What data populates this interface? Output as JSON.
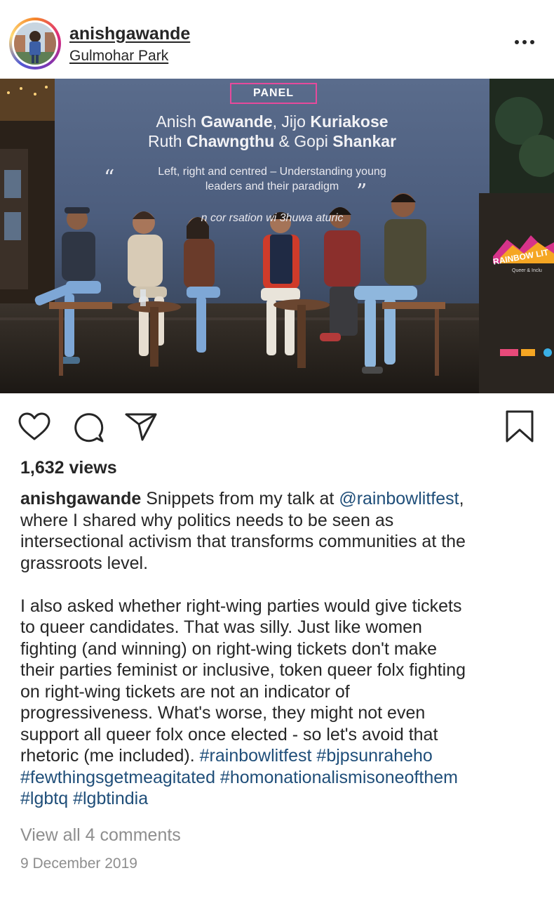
{
  "post": {
    "username": "anishgawande",
    "location": "Gulmohar Park",
    "more_icon": "more-horizontal-icon"
  },
  "media": {
    "screen": {
      "panel_tag": "PANEL",
      "speakers_line1_a": "Anish ",
      "speakers_line1_b": "Gawande",
      "speakers_line1_c": ", Jijo ",
      "speakers_line1_d": "Kuriakose",
      "speakers_line2_a": "Ruth ",
      "speakers_line2_b": "Chawngthu",
      "speakers_line2_c": " & Gopi ",
      "speakers_line2_d": "Shankar",
      "topic_line1": "Left, right and centred – Understanding young",
      "topic_line2": "leaders and their paradigm",
      "quote_open": "“",
      "quote_close": "”",
      "conversation": "n cor  rsation wi  3huwa   aturic"
    },
    "banner_title": "RAINBOW LIT",
    "banner_sub": "Queer & Inclu"
  },
  "actions": {
    "like_icon": "heart-icon",
    "comment_icon": "comment-bubble-icon",
    "share_icon": "paper-plane-icon",
    "save_icon": "bookmark-icon"
  },
  "stats": {
    "views": "1,632 views"
  },
  "caption": {
    "username": "anishgawande",
    "text_1": " Snippets from my talk at ",
    "mention": "@rainbowlitfest",
    "text_2": ",\nwhere I shared why politics needs to be seen as\nintersectional activism that transforms communities at the\ngrassroots level.\n\nI also asked whether right-wing parties would give tickets\nto queer candidates. That was silly. Just like women\nfighting (and winning) on right-wing tickets don't make\ntheir parties feminist or inclusive, token queer folx fighting\non right-wing tickets are not an indicator of\nprogressiveness. What's worse, they might not even\nsupport all queer folx once elected - so let's avoid that\nrhetoric (me included). ",
    "hashtags": [
      "#rainbowlitfest",
      "#bjpsunraheho",
      "#fewthingsgetmeagitated",
      "#homonationalismisoneofthem",
      "#lgbtq",
      "#lgbtindia"
    ]
  },
  "comments": {
    "view_all": "View all 4 comments"
  },
  "date": "9 December 2019",
  "colors": {
    "text": "#262626",
    "link": "#1f4e79",
    "muted": "#8e8e8e",
    "panel_border": "#e64a9c"
  }
}
